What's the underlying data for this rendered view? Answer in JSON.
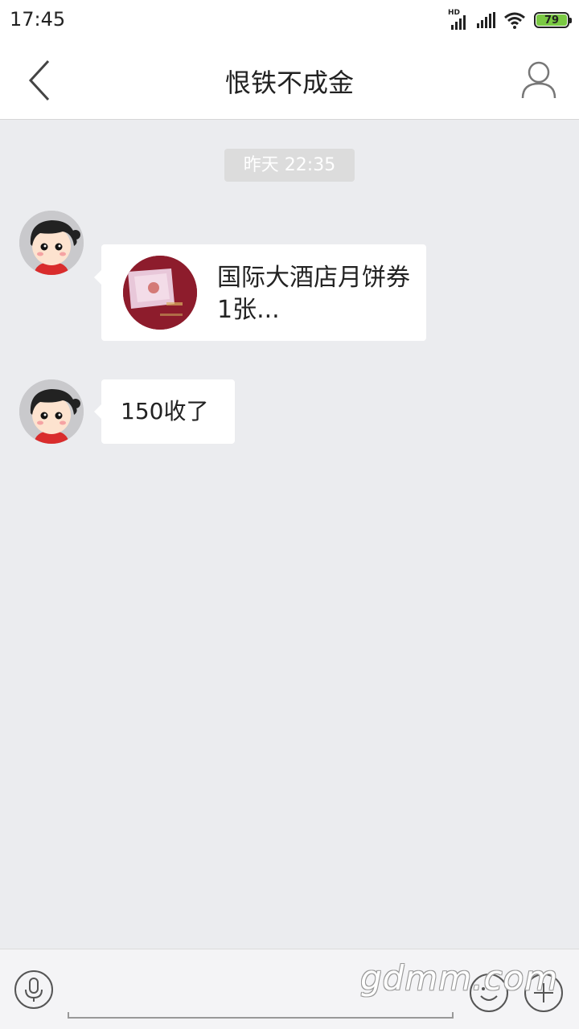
{
  "status_bar": {
    "time": "17:45",
    "hd_label": "HD",
    "battery_level": "79",
    "battery_color": "#7ac943"
  },
  "header": {
    "title": "恨铁不成金",
    "back_icon": "chevron-left-icon",
    "profile_icon": "user-outline-icon"
  },
  "chat": {
    "timestamp": "昨天 22:35",
    "messages": [
      {
        "type": "card",
        "thumb_icon": "mooncake-voucher-thumbnail",
        "text": "国际大酒店月饼券1张..."
      },
      {
        "type": "text",
        "text": "150收了"
      }
    ]
  },
  "input_bar": {
    "mic_icon": "microphone-icon",
    "emoji_icon": "smiley-icon",
    "plus_icon": "plus-icon"
  },
  "watermark": "gdmm.com"
}
